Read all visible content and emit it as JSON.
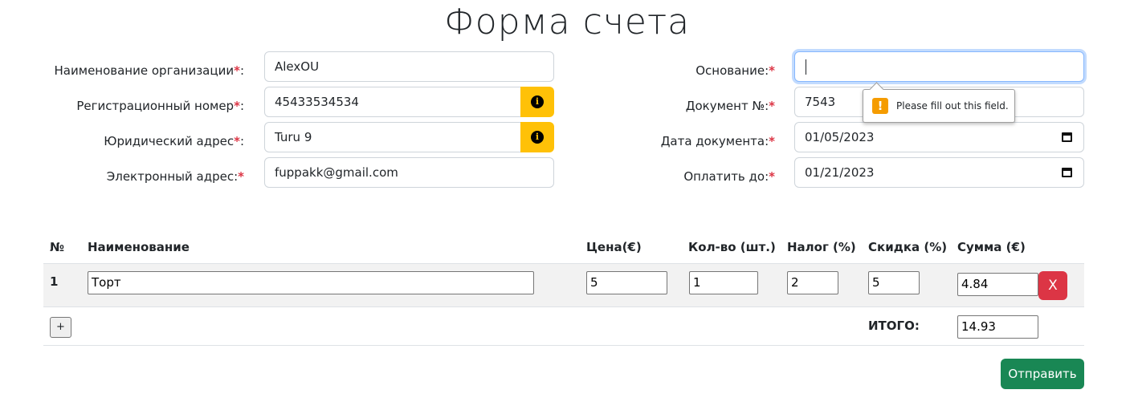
{
  "page": {
    "title": "Форма счета"
  },
  "left_fields": [
    {
      "label": "Наименование организации",
      "value": "AlexOU"
    },
    {
      "label": "Регистрационный номер",
      "value": "45433534534"
    },
    {
      "label": "Юридический адрес",
      "value": "Turu 9"
    },
    {
      "label": "Электронный адрес:",
      "value": "fuppakk@gmail.com"
    }
  ],
  "right_fields": [
    {
      "label": "Основание:",
      "value": ""
    },
    {
      "label": "Документ №:",
      "value": "7543"
    },
    {
      "label": "Дата документа:",
      "value": "01/05/2023"
    },
    {
      "label": "Оплатить до:",
      "value": "01/21/2023"
    }
  ],
  "required_mark": "*",
  "colon": ":",
  "info_icon": "i",
  "validation": {
    "message": "Please fill out this field.",
    "icon": "!"
  },
  "table": {
    "headers": [
      "№",
      "Наименование",
      "Цена(€)",
      "Кол-во (шт.)",
      "Налог (%)",
      "Скидка (%)",
      "Сумма (€)"
    ],
    "rows": [
      {
        "num": "1",
        "name": "Торт",
        "price": "5",
        "qty": "1",
        "tax": "2",
        "discount": "5",
        "sum": "4.84"
      }
    ],
    "delete_label": "X",
    "add_label": "+",
    "total_label": "ИТОГО:",
    "total_value": "14.93"
  },
  "submit_label": "Отправить",
  "colors": {
    "required": "#dc3545",
    "info_button": "#ffc107",
    "delete": "#dc3545",
    "submit": "#198754",
    "focus": "#86b7fe"
  }
}
